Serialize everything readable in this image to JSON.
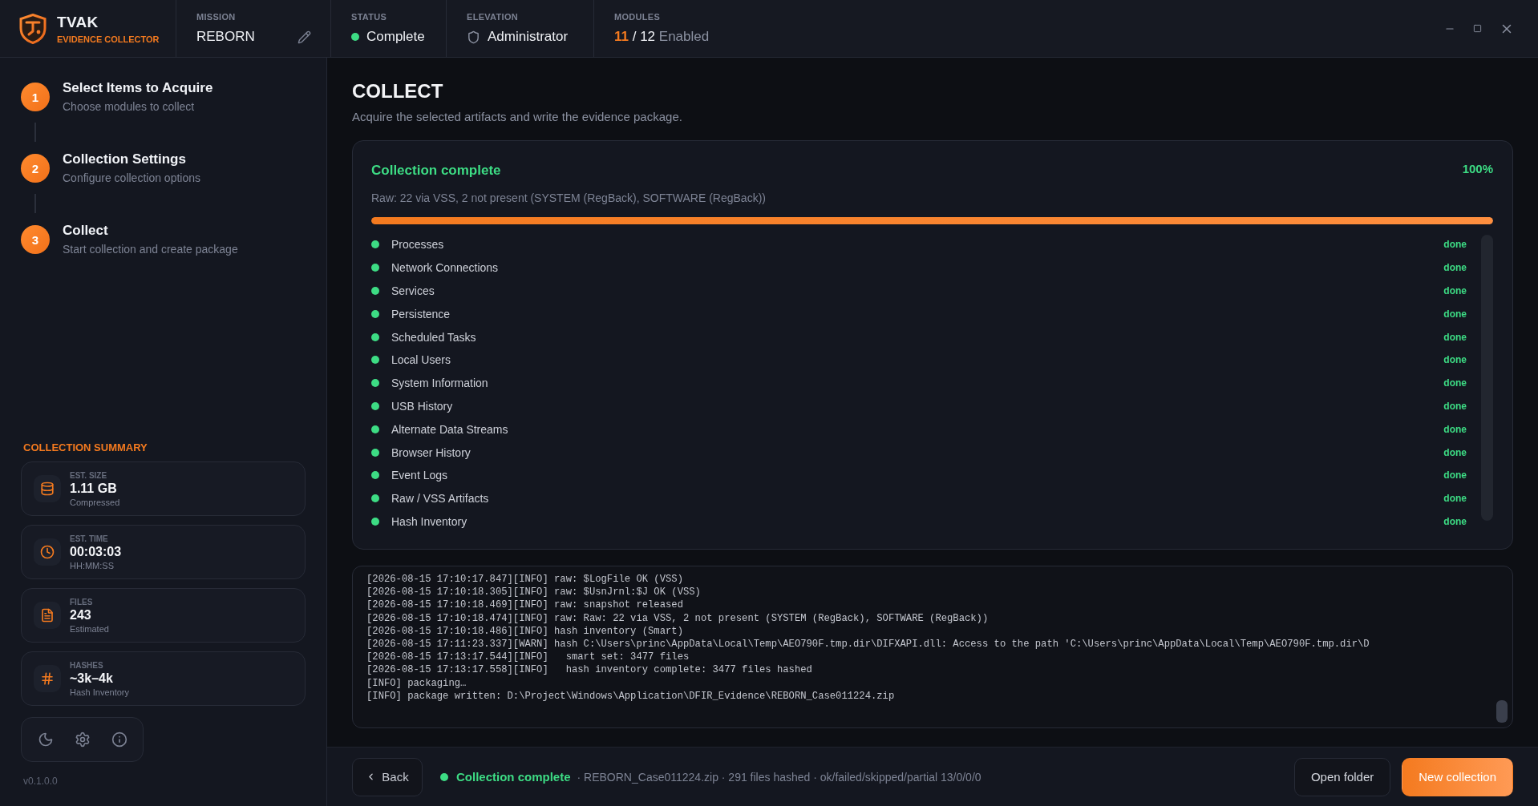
{
  "app": {
    "name": "TVAK",
    "tagline": "EVIDENCE COLLECTOR"
  },
  "header_fields": [
    {
      "kind": "editable",
      "label": "MISSION",
      "value": "REBORN"
    },
    {
      "kind": "status",
      "label": "STATUS",
      "value": "Complete"
    },
    {
      "kind": "role",
      "label": "ELEVATION",
      "value": "Administrator"
    },
    {
      "kind": "count",
      "label": "MODULES",
      "value": "11",
      "total": "/ 12",
      "unit": "Enabled"
    }
  ],
  "steps": [
    {
      "number": "1",
      "title": "Select Items to Acquire",
      "subtitle": "Choose modules to collect"
    },
    {
      "number": "2",
      "title": "Collection Settings",
      "subtitle": "Configure collection options"
    },
    {
      "number": "3",
      "title": "Collect",
      "subtitle": "Start collection and create package"
    }
  ],
  "summary": {
    "heading": "COLLECTION SUMMARY",
    "cards": [
      {
        "kind": "size",
        "label": "EST. SIZE",
        "value": "1.11 GB",
        "note": "Compressed"
      },
      {
        "kind": "time",
        "label": "EST. TIME",
        "value": "00:03:03",
        "note": "HH:MM:SS"
      },
      {
        "kind": "files",
        "label": "FILES",
        "value": "243",
        "note": "Estimated"
      },
      {
        "kind": "hashes",
        "label": "HASHES",
        "value": "~3k–4k",
        "note": "Hash Inventory"
      }
    ]
  },
  "version": "v0.1.0.0",
  "page": {
    "title": "COLLECT",
    "description": "Acquire the selected artifacts and write the evidence package."
  },
  "progress": {
    "title": "Collection complete",
    "percent": "100%",
    "detail": "Raw: 22 via VSS, 2 not present (SYSTEM (RegBack), SOFTWARE (RegBack))",
    "level": 1,
    "modules": [
      {
        "name": "Processes",
        "status": "done"
      },
      {
        "name": "Network Connections",
        "status": "done"
      },
      {
        "name": "Services",
        "status": "done"
      },
      {
        "name": "Persistence",
        "status": "done"
      },
      {
        "name": "Scheduled Tasks",
        "status": "done"
      },
      {
        "name": "Local Users",
        "status": "done"
      },
      {
        "name": "System Information",
        "status": "done"
      },
      {
        "name": "USB History",
        "status": "done"
      },
      {
        "name": "Alternate Data Streams",
        "status": "done"
      },
      {
        "name": "Browser History",
        "status": "done"
      },
      {
        "name": "Event Logs",
        "status": "done"
      },
      {
        "name": "Raw / VSS Artifacts",
        "status": "done"
      },
      {
        "name": "Hash Inventory",
        "status": "done"
      }
    ]
  },
  "log": {
    "lines": [
      "[2026-08-15 17:10:17.847][INFO] raw: $LogFile OK (VSS)",
      "[2026-08-15 17:10:18.305][INFO] raw: $UsnJrnl:$J OK (VSS)",
      "[2026-08-15 17:10:18.469][INFO] raw: snapshot released",
      "[2026-08-15 17:10:18.474][INFO] raw: Raw: 22 via VSS, 2 not present (SYSTEM (RegBack), SOFTWARE (RegBack))",
      "[2026-08-15 17:10:18.486][INFO] hash inventory (Smart)",
      "[2026-08-15 17:11:23.337][WARN] hash C:\\Users\\princ\\AppData\\Local\\Temp\\AEO790F.tmp.dir\\DIFXAPI.dll: Access to the path 'C:\\Users\\princ\\AppData\\Local\\Temp\\AEO790F.tmp.dir\\D",
      "[2026-08-15 17:13:17.544][INFO]   smart set: 3477 files",
      "[2026-08-15 17:13:17.558][INFO]   hash inventory complete: 3477 files hashed",
      "[INFO] packaging…",
      "[INFO] package written: D:\\Project\\Windows\\Application\\DFIR_Evidence\\REBORN_Case011224.zip"
    ]
  },
  "footer": {
    "back": "Back",
    "status": "Collection complete",
    "details": "· REBORN_Case011224.zip · 291 files hashed · ok/failed/skipped/partial 13/0/0/0",
    "buttons": [
      {
        "kind": "secondary",
        "label": "Open folder"
      },
      {
        "kind": "primary",
        "label": "New collection"
      }
    ]
  }
}
